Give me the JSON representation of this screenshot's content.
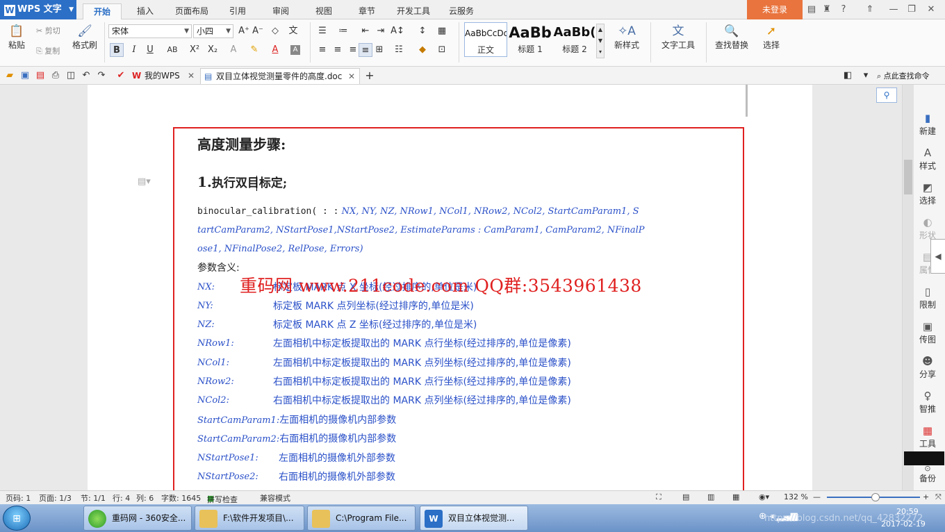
{
  "titlebar": {
    "app_name": "WPS 文字",
    "menus": [
      "开始",
      "插入",
      "页面布局",
      "引用",
      "审阅",
      "视图",
      "章节",
      "开发工具",
      "云服务"
    ],
    "active_menu": "开始",
    "login": "未登录",
    "help": "?"
  },
  "ribbon": {
    "paste": "粘贴",
    "cut": "剪切",
    "copy": "复制",
    "format_painter": "格式刷",
    "font_name": "宋体",
    "font_size": "小四",
    "bold": "B",
    "italic": "I",
    "underline": "U",
    "superscript": "X²",
    "subscript": "X₂",
    "styles": [
      {
        "preview": "AaBbCcDd",
        "label": "正文"
      },
      {
        "preview": "AaBb",
        "label": "标题 1"
      },
      {
        "preview": "AaBb(",
        "label": "标题 2"
      }
    ],
    "new_style": "新样式",
    "text_tools": "文字工具",
    "find_replace": "查找替换",
    "select": "选择"
  },
  "docbar": {
    "tabs": [
      {
        "label": "我的WPS"
      },
      {
        "label": "双目立体视觉测量零件的高度.doc"
      }
    ],
    "search": "点此查找命令"
  },
  "document": {
    "heading": "高度测量步骤:",
    "step_num": "1.",
    "step_text": "执行双目标定;",
    "code_lines": [
      {
        "fn": "binocular_calibration( : :",
        "args": " NX,  NY,  NZ,  NRow1,  NCol1,  NRow2,  NCol2,  StartCamParam1,  S"
      },
      {
        "args": "tartCamParam2,  NStartPose1,NStartPose2,  EstimateParams  :  CamParam1,  CamParam2,  NFinalP"
      },
      {
        "args": "ose1,  NFinalPose2,  RelPose,  Errors)"
      }
    ],
    "params_title": "参数含义:",
    "params": [
      {
        "name": "NX:",
        "desc": "标定板 MARK 点 X 坐标(经过排序的,单位是米)"
      },
      {
        "name": "NY:",
        "desc": "标定板 MARK 点列坐标(经过排序的,单位是米)"
      },
      {
        "name": "NZ:",
        "desc": "标定板 MARK 点 Z 坐标(经过排序的,单位是米)"
      },
      {
        "name": "NRow1:",
        "desc": "左面相机中标定板提取出的 MARK 点行坐标(经过排序的,单位是像素)"
      },
      {
        "name": "NCol1:",
        "desc": "左面相机中标定板提取出的 MARK 点列坐标(经过排序的,单位是像素)"
      },
      {
        "name": "NRow2:",
        "desc": "右面相机中标定板提取出的 MARK 点行坐标(经过排序的,单位是像素)"
      },
      {
        "name": "NCol2:",
        "desc": "右面相机中标定板提取出的 MARK 点列坐标(经过排序的,单位是像素)"
      },
      {
        "name": "StartCamParam1:",
        "desc": "左面相机的摄像机内部参数"
      },
      {
        "name": "StartCamParam2:",
        "desc": "右面相机的摄像机内部参数"
      },
      {
        "name": "NStartPose1:",
        "desc": "左面相机的摄像机外部参数"
      },
      {
        "name": "NStartPose2:",
        "desc": "右面相机的摄像机外部参数"
      }
    ],
    "watermark": "重码网 www.211code.com   QQ群:3543961438"
  },
  "sidepanel": {
    "items": [
      "新建",
      "样式",
      "选择",
      "形状",
      "属性",
      "限制",
      "传图",
      "分享",
      "智推",
      "工具",
      "备份"
    ]
  },
  "statusbar": {
    "page": "页码: 1",
    "pages": "页面: 1/3",
    "section": "节: 1/1",
    "row": "行: 4",
    "col": "列: 6",
    "words": "字数: 1645",
    "spellcheck": "拼写检查",
    "compat": "兼容模式",
    "zoom": "132 %"
  },
  "taskbar": {
    "tasks": [
      "重码网 - 360安全...",
      "F:\\软件开发项目\\...",
      "C:\\Program File...",
      "双目立体视觉测..."
    ],
    "time": "20:59",
    "date": "2017-02-19",
    "url_overlay": "https://blog.csdn.net/qq_42832272"
  }
}
